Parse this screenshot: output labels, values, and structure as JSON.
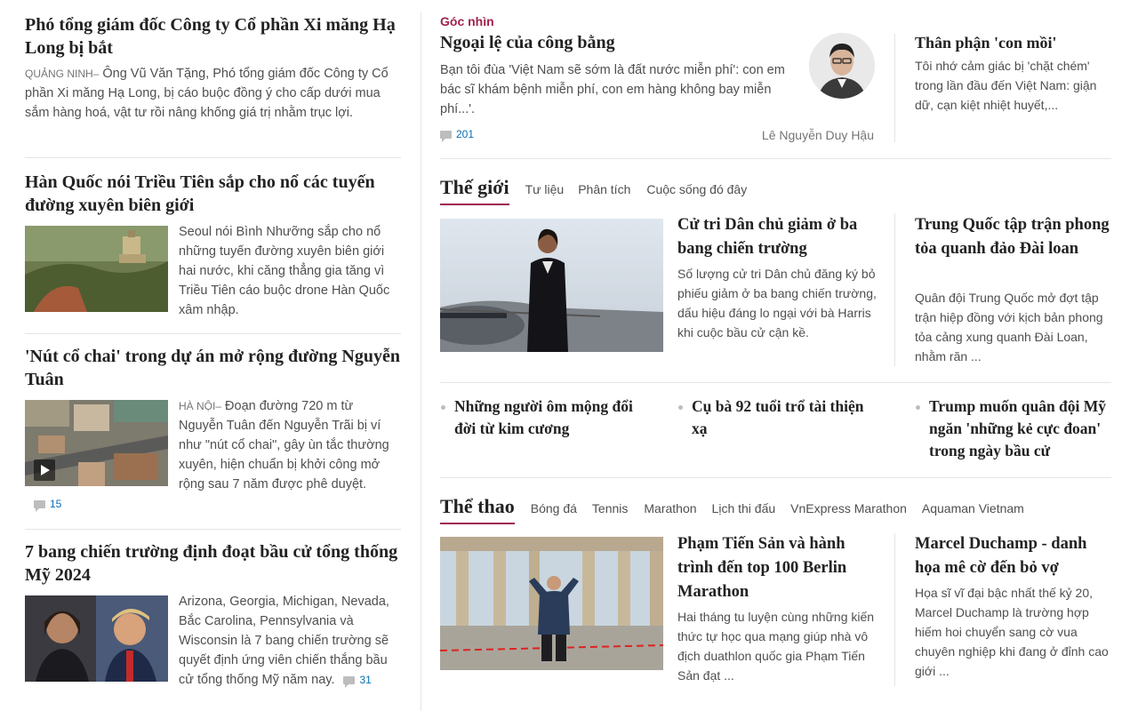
{
  "left_articles": [
    {
      "title": "Phó tổng giám đốc Công ty Cổ phần Xi măng Hạ Long bị bắt",
      "location": "QUẢNG NINH–",
      "desc": " Ông Vũ Văn Tặng, Phó tổng giám đốc Công ty Cổ phần Xi măng Hạ Long, bị cáo buộc đồng ý cho cấp dưới mua sắm hàng hoá, vật tư rồi nâng khống giá trị nhằm trục lợi."
    },
    {
      "title": "Hàn Quốc nói Triều Tiên sắp cho nổ các tuyến đường xuyên biên giới",
      "location": "",
      "desc": "Seoul nói Bình Nhưỡng sắp cho nổ những tuyến đường xuyên biên giới hai nước, khi căng thẳng gia tăng vì Triều Tiên cáo buộc drone Hàn Quốc xâm nhập."
    },
    {
      "title": "'Nút cổ chai' trong dự án mở rộng đường Nguyễn Tuân",
      "location": "HÀ NỘI–",
      "desc": " Đoạn đường 720 m từ Nguyễn Tuân đến Nguyễn Trãi bị ví như \"nút cổ chai\", gây ùn tắc thường xuyên, hiện chuẩn bị khởi công mở rộng sau 7 năm được phê duyệt.",
      "comments": "15"
    },
    {
      "title": "7 bang chiến trường định đoạt bầu cử tổng thống Mỹ 2024",
      "location": "",
      "desc": "Arizona, Georgia, Michigan, Nevada, Bắc Carolina, Pennsylvania và Wisconsin là 7 bang chiến trường sẽ quyết định ứng viên chiến thắng bầu cử tổng thống Mỹ năm nay.",
      "comments": "31"
    }
  ],
  "goc_nhin": {
    "label": "Góc nhìn",
    "title": "Ngoại lệ của công bằng",
    "desc": "Bạn tôi đùa 'Việt Nam sẽ sớm là đất nước miễn phí': con em bác sĩ khám bệnh miễn phí, con em hàng không bay miễn phí...'.",
    "comments": "201",
    "author": "Lê Nguyễn Duy Hậu",
    "side_title": "Thân phận 'con mồi'",
    "side_desc": "Tôi nhớ cảm giác bị 'chặt chém' trong lần đầu đến Việt Nam: giận dữ, cạn kiệt nhiệt huyết,..."
  },
  "the_gioi": {
    "title": "Thế giới",
    "subs": [
      "Tư liệu",
      "Phân tích",
      "Cuộc sống đó đây"
    ],
    "main_title": "Cử tri Dân chủ giảm ở ba bang chiến trường",
    "main_desc": "Số lượng cử tri Dân chủ đăng ký bỏ phiếu giảm ở ba bang chiến trường, dấu hiệu đáng lo ngại với bà Harris khi cuộc bầu cử cận kề.",
    "side_title": "Trung Quốc tập trận phong tỏa quanh đảo Đài loan",
    "side_desc": "Quân đội Trung Quốc mở đợt tập trận hiệp đồng với kịch bản phong tỏa cảng xung quanh Đài Loan, nhằm răn ...",
    "bullets": [
      "Những người ôm mộng đổi đời từ kim cương",
      "Cụ bà 92 tuổi trổ tài thiện xạ",
      "Trump muốn quân đội Mỹ ngăn 'những kẻ cực đoan' trong ngày bầu cử"
    ]
  },
  "the_thao": {
    "title": "Thể thao",
    "subs": [
      "Bóng đá",
      "Tennis",
      "Marathon",
      "Lịch thi đấu",
      "VnExpress Marathon",
      "Aquaman Vietnam"
    ],
    "main_title": "Phạm Tiến Sản và hành trình đến top 100 Berlin Marathon",
    "main_desc": "Hai tháng tu luyện cùng những kiến thức tự học qua mạng giúp nhà vô địch duathlon quốc gia Phạm Tiến Sản đạt ...",
    "side_title": "Marcel Duchamp - danh họa mê cờ đến bỏ vợ",
    "side_desc": "Họa sĩ vĩ đại bậc nhất thế kỷ 20, Marcel Duchamp là trường hợp hiếm hoi chuyển sang cờ vua chuyên nghiệp khi đang ở đỉnh cao giới ..."
  },
  "colors": {
    "accent": "#9f224e",
    "link": "#076db6"
  }
}
